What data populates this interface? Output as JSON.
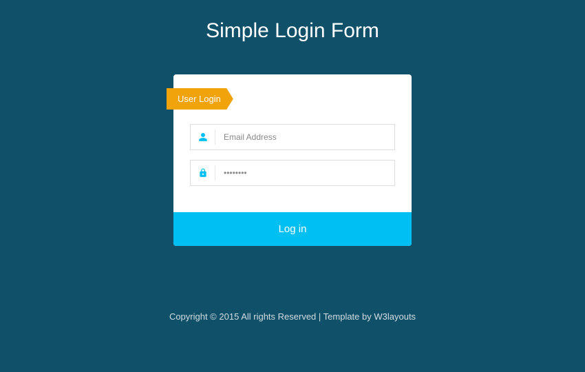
{
  "page": {
    "title": "Simple Login Form"
  },
  "card": {
    "ribbon_label": "User Login"
  },
  "form": {
    "email_placeholder": "Email Address",
    "password_placeholder": "••••••••",
    "submit_label": "Log in"
  },
  "footer": {
    "text": "Copyright © 2015 All rights Reserved | Template by ",
    "link_text": "W3layouts"
  },
  "colors": {
    "background": "#115069",
    "accent": "#00bff3",
    "ribbon": "#f0a30a"
  }
}
